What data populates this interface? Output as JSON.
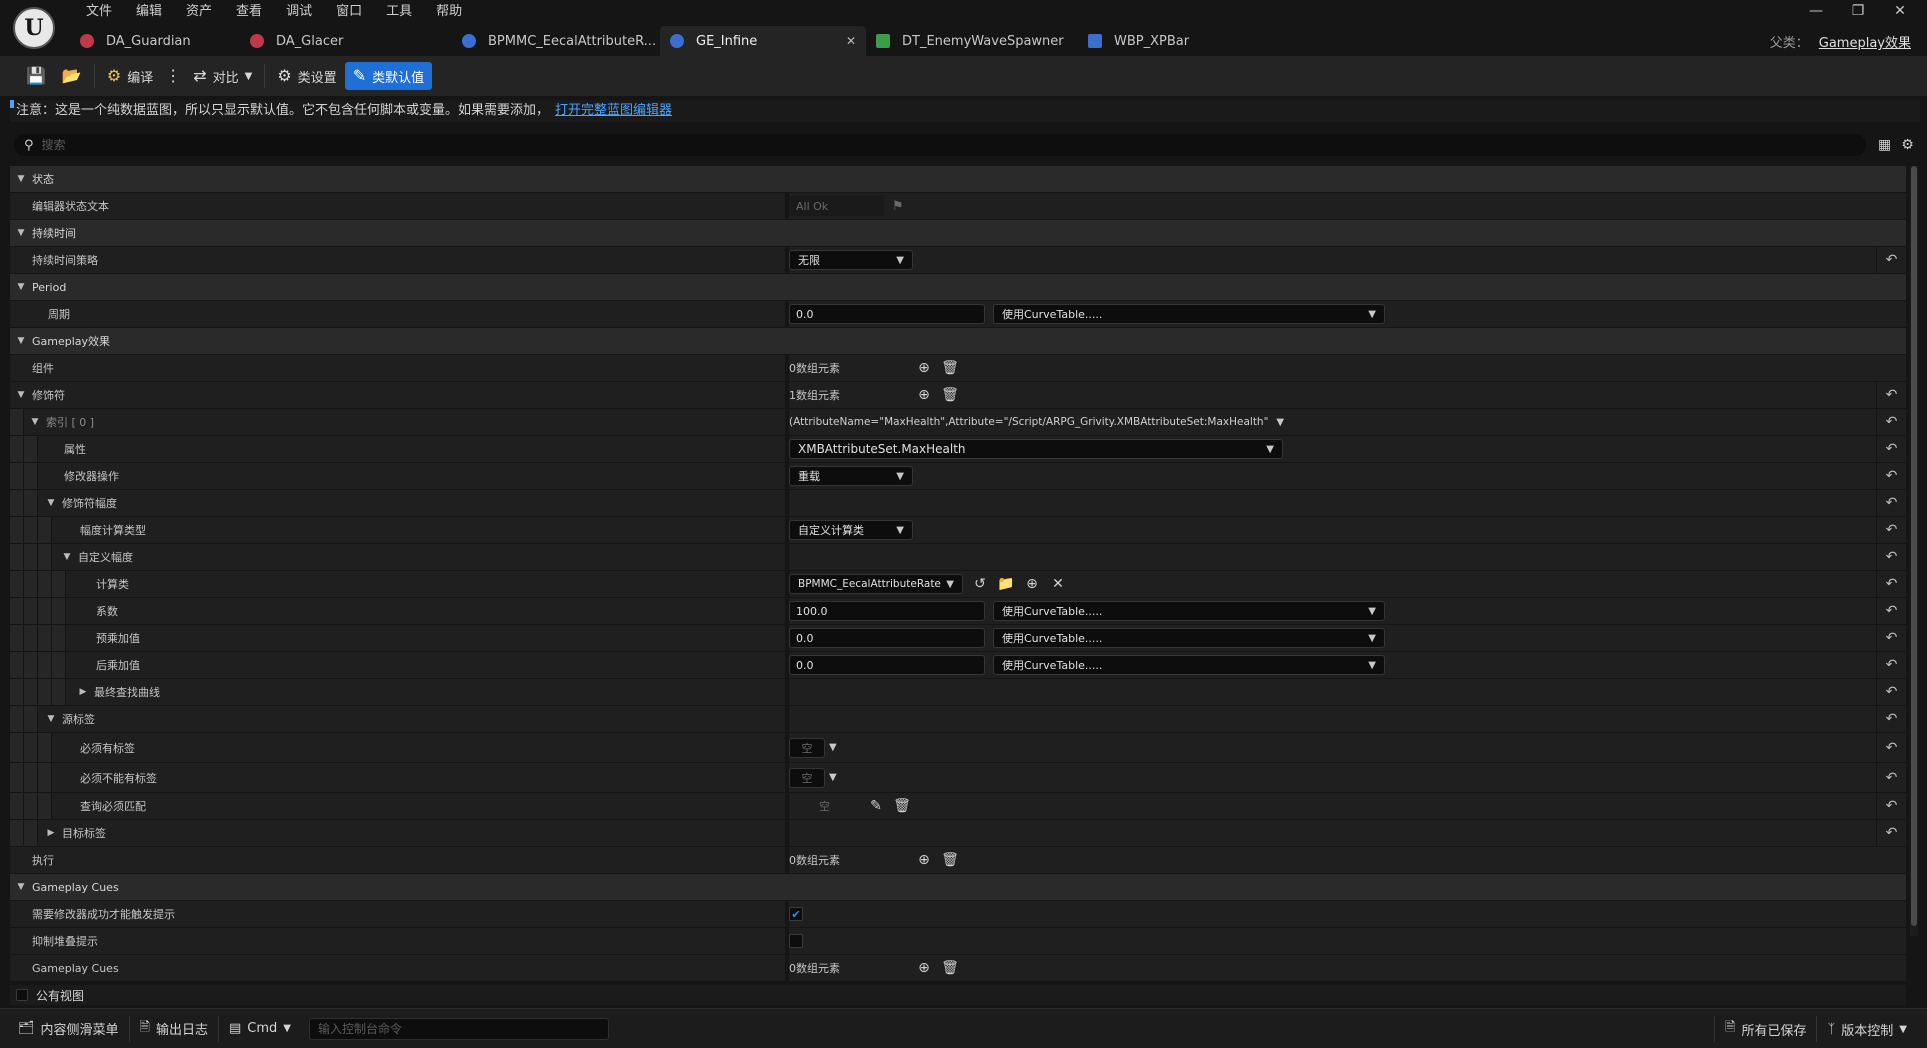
{
  "menu": [
    "文件",
    "编辑",
    "资产",
    "查看",
    "调试",
    "窗口",
    "工具",
    "帮助"
  ],
  "tabs": [
    {
      "label": "DA_Guardian",
      "color": "#c0384a",
      "active": false
    },
    {
      "label": "DA_Glacer",
      "color": "#c0384a",
      "active": false
    },
    {
      "label": "BPMMC_EecalAttributeR...",
      "color": "#3a6fd0",
      "active": false
    },
    {
      "label": "GE_Infine",
      "color": "#3a6fd0",
      "active": true
    },
    {
      "label": "DT_EnemyWaveSpawner",
      "color": "#3d9c4a",
      "active": false
    },
    {
      "label": "WBP_XPBar",
      "color": "#3a6fd0",
      "active": false
    }
  ],
  "parent": {
    "label": "父类：",
    "value": "Gameplay效果"
  },
  "toolbar": {
    "compile": "编译",
    "diff": "对比",
    "class_settings": "类设置",
    "class_defaults": "类默认值"
  },
  "notice": {
    "text": "注意：这是一个纯数据蓝图，所以只显示默认值。它不包含任何脚本或变量。如果需要添加，",
    "link": "打开完整蓝图编辑器"
  },
  "search": {
    "placeholder": "搜索"
  },
  "rows": {
    "cat_state": "状态",
    "editor_state_text": "编辑器状态文本",
    "editor_state_value": "All Ok",
    "cat_duration": "持续时间",
    "duration_policy": "持续时间策略",
    "duration_policy_value": "无限",
    "cat_period": "Period",
    "period": "周期",
    "period_value": "0.0",
    "curve_table": "使用CurveTable.....",
    "cat_gameplay_effect": "Gameplay效果",
    "components": "组件",
    "components_value": "0数组元素",
    "modifiers": "修饰符",
    "modifiers_value": "1数组元素",
    "index0": "索引 [ 0 ]",
    "index0_value": "(AttributeName=\"MaxHealth\",Attribute=\"/Script/ARPG_Grivity.XMBAttributeSet:MaxHealth\"",
    "attribute": "属性",
    "attribute_value": "XMBAttributeSet.MaxHealth",
    "modifier_op": "修改器操作",
    "modifier_op_value": "重载",
    "modifier_magnitude": "修饰符幅度",
    "magnitude_calc_type": "幅度计算类型",
    "magnitude_calc_type_value": "自定义计算类",
    "custom_magnitude": "自定义幅度",
    "calc_class": "计算类",
    "calc_class_value": "BPMMC_EecalAttributeRate",
    "coefficient": "系数",
    "coefficient_value": "100.0",
    "pre_add": "预乘加值",
    "pre_add_value": "0.0",
    "post_add": "后乘加值",
    "post_add_value": "0.0",
    "final_lookup_curve": "最终查找曲线",
    "source_tags": "源标签",
    "require_tags": "必须有标签",
    "ignore_tags": "必须不能有标签",
    "empty": "空",
    "query_must_match": "查询必须匹配",
    "target_tags": "目标标签",
    "executions": "执行",
    "executions_value": "0数组元素",
    "cat_gameplay_cues": "Gameplay Cues",
    "require_modifier_success": "需要修改器成功才能触发提示",
    "suppress_stacking": "抑制堆叠提示",
    "gameplay_cues": "Gameplay Cues",
    "gameplay_cues_value": "0数组元素"
  },
  "public_view": "公有视图",
  "statusbar": {
    "content_drawer": "内容侧滑菜单",
    "output_log": "输出日志",
    "cmd": "Cmd",
    "console_placeholder": "输入控制台命令",
    "all_saved": "所有已保存",
    "source_control": "版本控制"
  }
}
